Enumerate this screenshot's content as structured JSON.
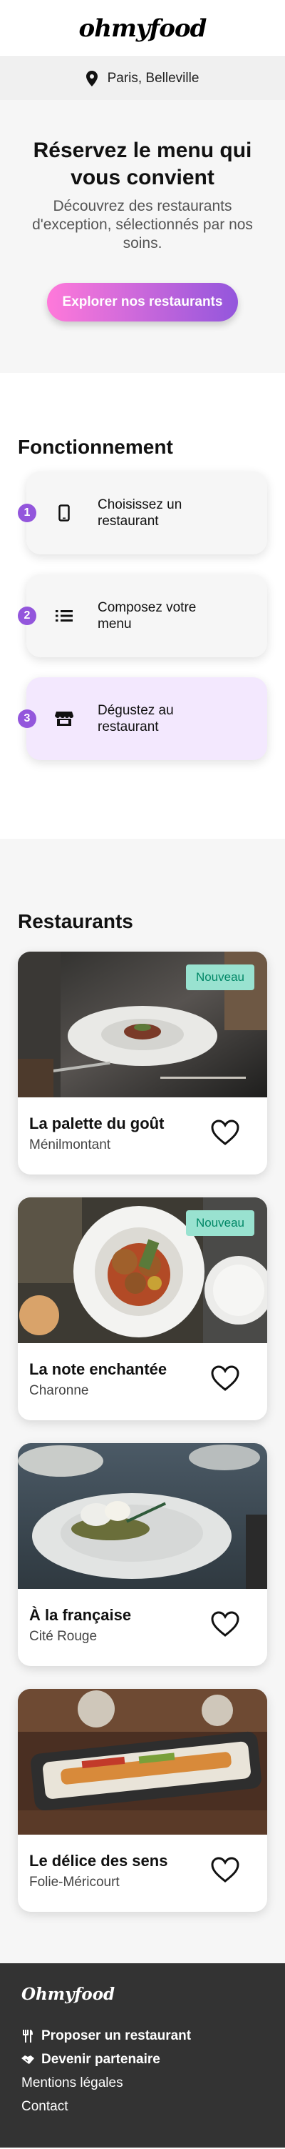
{
  "header": {
    "logo": "ohmyfood",
    "location": "Paris, Belleville"
  },
  "hero": {
    "title": "Réservez le menu qui vous convient",
    "subtitle": "Découvrez des restaurants d'exception, sélectionnés par nos soins.",
    "cta_label": "Explorer nos restaurants"
  },
  "how": {
    "title": "Fonctionnement",
    "steps": [
      {
        "number": "1",
        "label": "Choisissez un restaurant",
        "icon": "smartphone-icon"
      },
      {
        "number": "2",
        "label": "Composez votre menu",
        "icon": "list-icon"
      },
      {
        "number": "3",
        "label": "Dégustez au restaurant",
        "icon": "store-icon"
      }
    ]
  },
  "restaurants": {
    "title": "Restaurants",
    "items": [
      {
        "name": "La palette du goût",
        "location": "Ménilmontant",
        "badge": "Nouveau"
      },
      {
        "name": "La note enchantée",
        "location": "Charonne",
        "badge": "Nouveau"
      },
      {
        "name": "À la française",
        "location": "Cité Rouge",
        "badge": ""
      },
      {
        "name": "Le délice des sens",
        "location": "Folie-Méricourt",
        "badge": ""
      }
    ]
  },
  "footer": {
    "logo": "Ohmyfood",
    "links": [
      {
        "label": "Proposer un restaurant",
        "icon": "utensils-icon"
      },
      {
        "label": "Devenir partenaire",
        "icon": "handshake-icon"
      },
      {
        "label": "Mentions légales",
        "icon": ""
      },
      {
        "label": "Contact",
        "icon": ""
      }
    ]
  },
  "colors": {
    "primary": "#9356dc",
    "secondary": "#ff79da",
    "badge_bg": "#99e2d0",
    "badge_text": "#008766",
    "footer_bg": "#333333"
  }
}
